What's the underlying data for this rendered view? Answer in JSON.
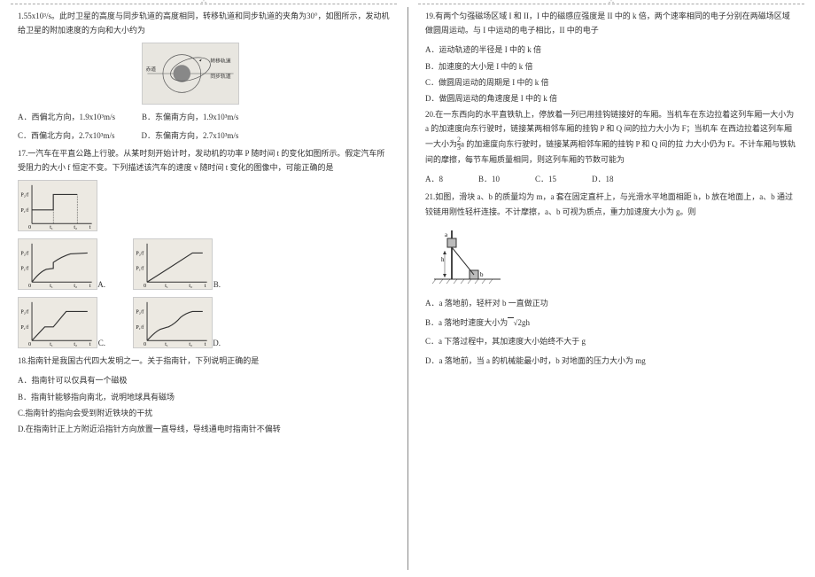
{
  "page_marker": "-'-",
  "left": {
    "q16_intro": "1.55x10³/s。此时卫星的高度与同步轨道的高度相同，转移轨道和同步轨道的夹角为30°，如图所示，发动机给卫星的附加速度的方向和大小约为",
    "orbit_labels": {
      "equator": "赤道",
      "sync": "同步轨道",
      "transfer": "转移轨道"
    },
    "q16_opts": {
      "A": "A．西偏北方向，1.9x10³m/s",
      "B": "B．东偏南方向，1.9x10³m/s",
      "C": "C．西偏北方向，2.7x10³m/s",
      "D": "D．东偏南方向，2.7x10³m/s"
    },
    "q17": "17.一汽车在平直公路上行驶。从某时刻开始计时，发动机的功率 P 随时间 t 的变化如图所示。假定汽车所受阻力的大小 f 恒定不变。下列描述该汽车的速度 v 随时间 t 变化的图像中，可能正确的是",
    "graph_y1": "P₂/f",
    "graph_y2": "P₁/f",
    "graph_x1": "t₁",
    "graph_x2": "t₂",
    "graph_t": "t",
    "graph_o": "0",
    "g_labels": {
      "A": "A.",
      "B": "B.",
      "C": "C.",
      "D": "D."
    },
    "q18": "18.指南针是我国古代四大发明之一。关于指南针，下列说明正确的是",
    "q18_opts": {
      "A": "A．指南针可以仅具有一个磁极",
      "B": "B．指南针能够指向南北，说明地球具有磁场",
      "C": "C.指南针的指向会受到附近铁块的干扰",
      "D": "D.在指南针正上方附近沿指针方向放置一直导线，导线通电时指南针不偏转"
    }
  },
  "right": {
    "q19": "19.有两个匀强磁场区域 I 和 II，I 中的磁感应强度是 II 中的 k 倍，两个速率相同的电子分别在两磁场区域做圆周运动。与 I 中运动的电子相比，II 中的电子",
    "q19_opts": {
      "A": "A．运动轨迹的半径是 I 中的 k 倍",
      "B": "B．加速度的大小是 I 中的 k 倍",
      "C": "C．做圆周运动的周期是 I 中的 k 倍",
      "D": "D．做圆周运动的角速度是 I 中的 k 倍"
    },
    "q20_a": "20.在一东西向的水平直铁轨上，停放着一列已用挂钩链接好的车厢。当机车在东边拉着这列车厢一大小为 a 的加速度向东行驶时，链接某两相邻车厢的挂钩 P 和 Q 间的拉力大小为 F；当机车",
    "q20_b": "在西边拉着这列车厢一大小为",
    "q20_frac_n": "2",
    "q20_frac_d": "3",
    "q20_c": "a 的加速度向东行驶时，链接某两相邻车厢的挂钩 P 和 Q 间的拉",
    "q20_d": "力大小仍为 F。不计车厢与铁轨间的摩擦，每节车厢质量相同，则这列车厢的节数可能为",
    "q20_opts": {
      "A": "A．8",
      "B": "B．10",
      "C": "C．15",
      "D": "D．18"
    },
    "q21": "21.如图，滑块 a、b 的质量均为 m，a 套在固定直杆上，与光滑水平地面相距 h，b 放在地面上，a、b 通过铰链用刚性轻杆连接。不计摩擦，a、b 可视为质点，重力加速度大小为 g。则",
    "q21_opts": {
      "A": "A．a 落地前，轻杆对 b 一直做正功",
      "B_pre": "B．a 落地时速度大小为",
      "B_rad": "√2gh",
      "C": "C．a 下落过程中，其加速度大小始终不大于 g",
      "D": "D．a 落地前，当 a 的机械能最小时，b 对地面的压力大小为 mg"
    }
  }
}
